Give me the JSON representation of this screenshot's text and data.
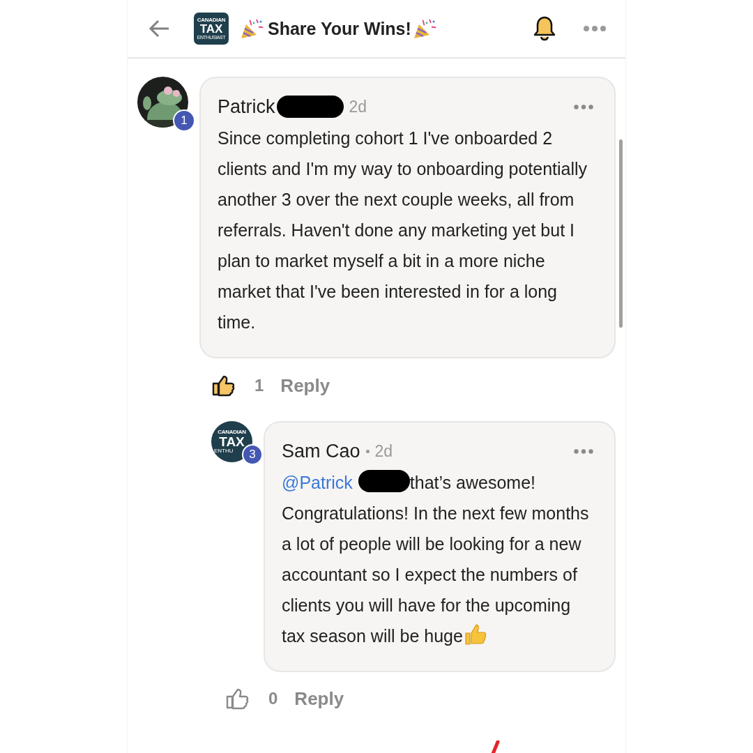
{
  "header": {
    "title": "Share Your Wins!",
    "logo": [
      "CANADIAN",
      "TAX",
      "ENTHUSIAST"
    ]
  },
  "comments": [
    {
      "author": "Patrick",
      "redacted": true,
      "dot": false,
      "time": "2d",
      "avatar": {
        "kind": "picture",
        "badge": "1"
      },
      "body": "Since completing cohort 1 I've onboarded 2 clients and I'm my way to onboarding potentially another 3 over the next couple weeks, all from referrals. Haven't done any marketing yet but I plan to market myself a bit in a more niche market that I've been interested in for a long time.",
      "end_emoji": false,
      "likes": "1",
      "liked": true,
      "reply": "Reply",
      "replies": [
        {
          "author": "Sam Cao",
          "redacted": false,
          "dot": true,
          "time": "2d",
          "avatar": {
            "kind": "logo",
            "badge": "3",
            "logo": [
              "CANADIAN",
              "TAX",
              "ENTHU"
            ]
          },
          "mention": "@Patrick",
          "body": "that’s awesome! Congratulations! In the next few months a lot of people will be looking for a new accountant so I expect the numbers of clients you will have for the upcoming tax season will be huge",
          "end_emoji": true,
          "likes": "0",
          "liked": false,
          "reply": "Reply"
        }
      ]
    }
  ]
}
